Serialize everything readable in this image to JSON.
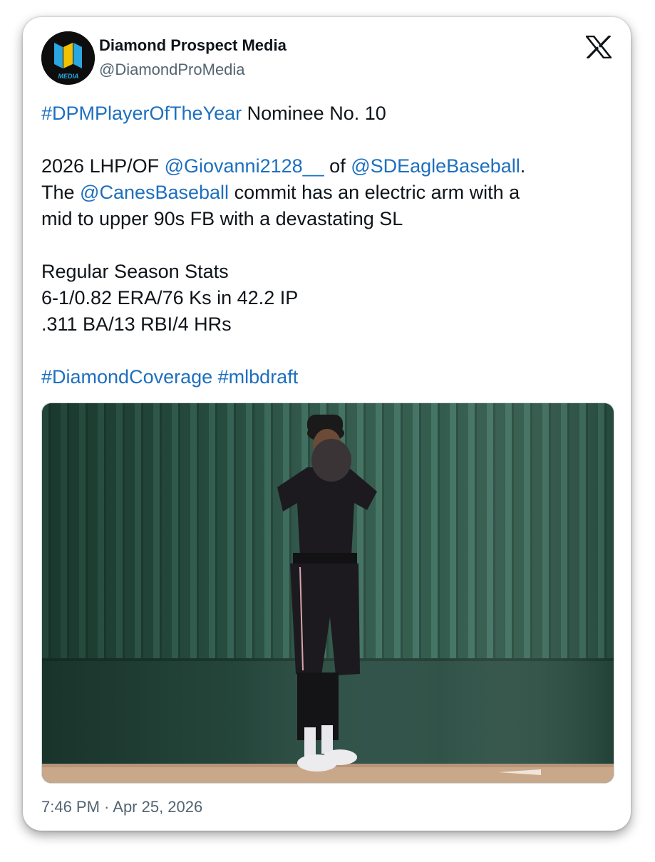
{
  "author": {
    "display_name": "Diamond Prospect Media",
    "handle": "@DiamondProMedia",
    "avatar_text": "MEDIA"
  },
  "platform_icon": "x-logo-icon",
  "tweet": {
    "line1": {
      "hashtag": "#DPMPlayerOfTheYear",
      "text": " Nominee No. 10"
    },
    "line2": {
      "prefix": "2026 LHP/OF ",
      "mention1": "@Giovanni2128__",
      "mid": " of ",
      "mention2": "@SDEagleBaseball",
      "suffix": "."
    },
    "line3": {
      "prefix": "The ",
      "mention": "@CanesBaseball",
      "suffix": " commit has an electric arm with a"
    },
    "line4": "mid to upper 90s FB with a devastating SL",
    "stats_header": "Regular Season Stats",
    "stats_pitching": "6-1/0.82 ERA/76 Ks in 42.2 IP",
    "stats_hitting": ".311 BA/13 RBI/4 HRs",
    "hashtags": [
      "#DiamondCoverage",
      "#mlbdraft"
    ]
  },
  "media": {
    "description": "pitcher-photo"
  },
  "timestamp": "7:46 PM · Apr 25, 2026",
  "colors": {
    "link": "#1d6fbf",
    "text": "#0f1419",
    "muted": "#536471",
    "wall": "#2f5a4c"
  }
}
